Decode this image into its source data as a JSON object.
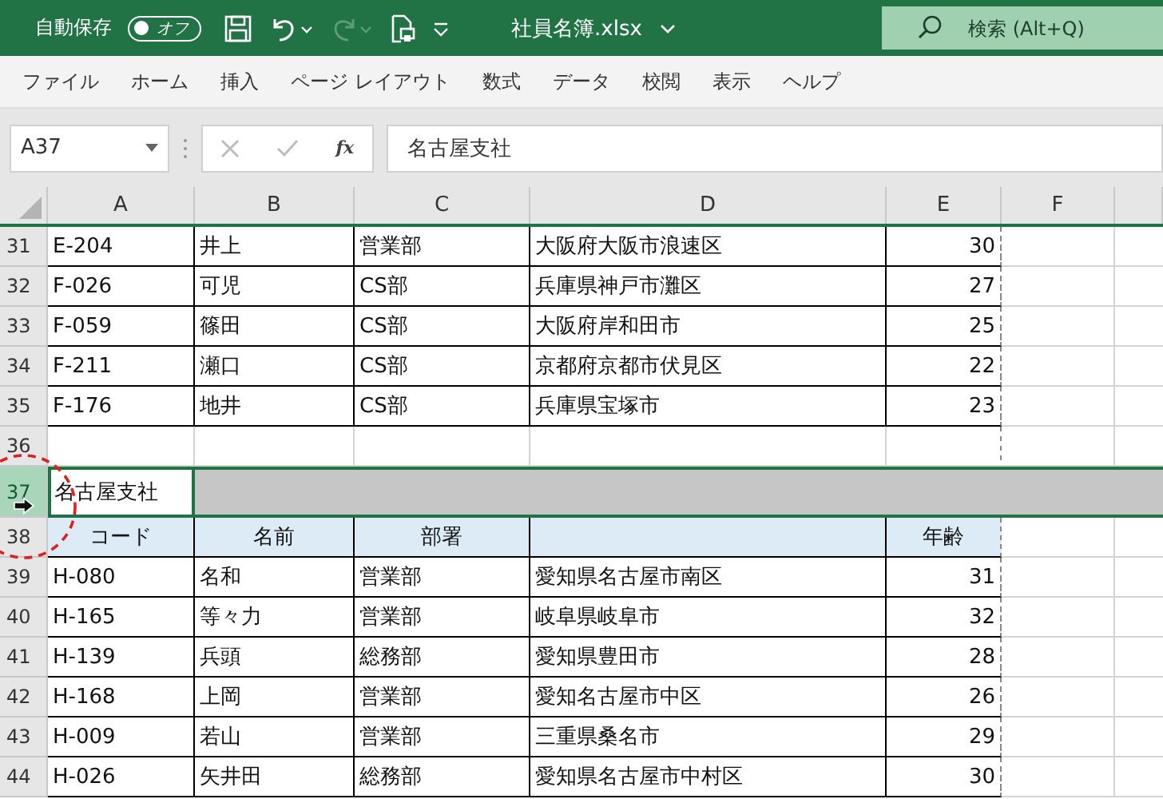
{
  "title_bar": {
    "autosave_label": "自動保存",
    "autosave": {
      "on": false,
      "label": "オフ"
    },
    "redo": {
      "disabled": true
    },
    "file_name": "社員名簿.xlsx",
    "search": {
      "placeholder": "検索 (Alt+Q)"
    }
  },
  "menu": [
    "ファイル",
    "ホーム",
    "挿入",
    "ページ レイアウト",
    "数式",
    "データ",
    "校閲",
    "表示",
    "ヘルプ"
  ],
  "formula_bar": {
    "name_box": "A37",
    "function_label": "fx",
    "value": "名古屋支社"
  },
  "columns": [
    "A",
    "B",
    "C",
    "D",
    "E",
    "F"
  ],
  "rows": [
    {
      "number": "31",
      "kind": "data",
      "cells": [
        "E-204",
        "井上",
        "営業部",
        "大阪府大阪市浪速区",
        "30"
      ]
    },
    {
      "number": "32",
      "kind": "data",
      "cells": [
        "F-026",
        "可児",
        "CS部",
        "兵庫県神戸市灘区",
        "27"
      ]
    },
    {
      "number": "33",
      "kind": "data",
      "cells": [
        "F-059",
        "篠田",
        "CS部",
        "大阪府岸和田市",
        "25"
      ]
    },
    {
      "number": "34",
      "kind": "data",
      "cells": [
        "F-211",
        "瀬口",
        "CS部",
        "京都府京都市伏見区",
        "22"
      ]
    },
    {
      "number": "35",
      "kind": "data",
      "cells": [
        "F-176",
        "地井",
        "CS部",
        "兵庫県宝塚市",
        "23"
      ]
    },
    {
      "number": "36",
      "kind": "blank"
    },
    {
      "number": "37",
      "kind": "selected",
      "cells": [
        "名古屋支社"
      ]
    },
    {
      "number": "38",
      "kind": "header",
      "cells": [
        "コード",
        "名前",
        "部署"
      ],
      "column_e": "年齢"
    },
    {
      "number": "39",
      "kind": "data",
      "cells": [
        "H-080",
        "名和",
        "営業部",
        "愛知県名古屋市南区",
        "31"
      ]
    },
    {
      "number": "40",
      "kind": "data",
      "cells": [
        "H-165",
        "等々力",
        "営業部",
        "岐阜県岐阜市",
        "32"
      ]
    },
    {
      "number": "41",
      "kind": "data",
      "cells": [
        "H-139",
        "兵頭",
        "総務部",
        "愛知県豊田市",
        "28"
      ]
    },
    {
      "number": "42",
      "kind": "data",
      "cells": [
        "H-168",
        "上岡",
        "営業部",
        "愛知名古屋市中区",
        "26"
      ]
    },
    {
      "number": "43",
      "kind": "data",
      "cells": [
        "H-009",
        "若山",
        "営業部",
        "三重県桑名市",
        "29"
      ]
    },
    {
      "number": "44",
      "kind": "data",
      "cells": [
        "H-026",
        "矢井田",
        "総務部",
        "愛知県名古屋市中村区",
        "30"
      ]
    }
  ]
}
